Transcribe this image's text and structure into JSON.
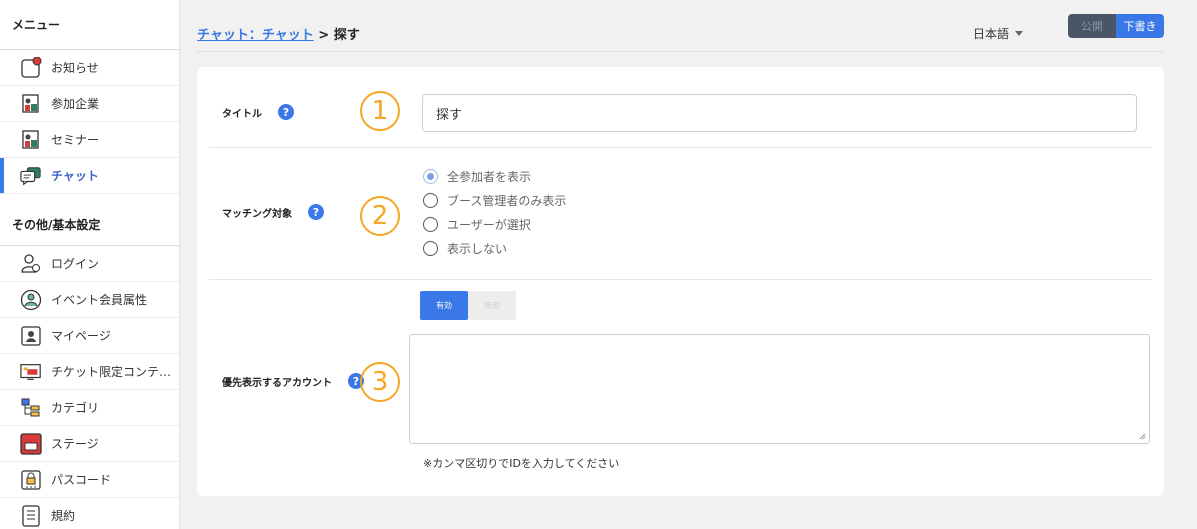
{
  "sidebar": {
    "menu_title": "メニュー",
    "menu_items": [
      {
        "label": "お知らせ",
        "icon": "notification-icon"
      },
      {
        "label": "参加企業",
        "icon": "company-icon"
      },
      {
        "label": "セミナー",
        "icon": "seminar-icon"
      },
      {
        "label": "チャット",
        "icon": "chat-icon"
      }
    ],
    "settings_title": "その他/基本設定",
    "settings_items": [
      {
        "label": "ログイン",
        "icon": "login-icon"
      },
      {
        "label": "イベント会員属性",
        "icon": "member-attribute-icon"
      },
      {
        "label": "マイページ",
        "icon": "mypage-icon"
      },
      {
        "label": "チケット限定コンテ…",
        "icon": "ticket-content-icon"
      },
      {
        "label": "カテゴリ",
        "icon": "category-icon"
      },
      {
        "label": "ステージ",
        "icon": "stage-icon"
      },
      {
        "label": "パスコード",
        "icon": "passcode-icon"
      },
      {
        "label": "規約",
        "icon": "terms-icon"
      }
    ]
  },
  "breadcrumb": {
    "link": "チャット：チャット",
    "separator": ">",
    "current": "探す"
  },
  "language": {
    "selected": "日本語"
  },
  "publish": {
    "public_label": "公開",
    "draft_label": "下書き"
  },
  "form": {
    "title_row": {
      "label": "タイトル",
      "number": "1",
      "value": "探す"
    },
    "matching_row": {
      "label": "マッチング対象",
      "number": "2",
      "options": [
        "全参加者を表示",
        "ブース管理者のみ表示",
        "ユーザーが選択",
        "表示しない"
      ]
    },
    "priority_row": {
      "label": "優先表示するアカウント",
      "number": "3",
      "enabled_label": "有効",
      "disabled_label": "無効",
      "textarea_value": "",
      "hint": "※カンマ区切りでIDを入力してください"
    }
  },
  "colors": {
    "accent": "#3b78e7",
    "marker": "#f5a623"
  }
}
